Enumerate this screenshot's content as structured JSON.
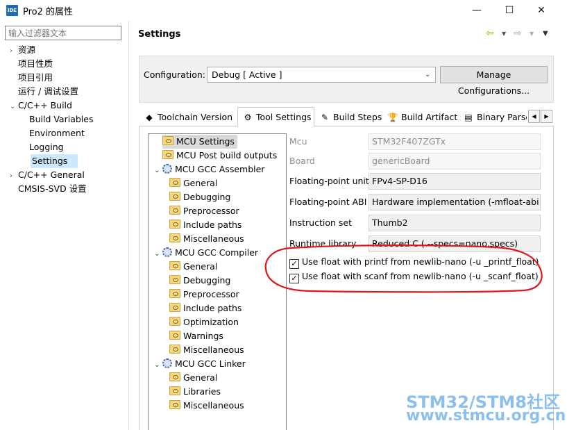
{
  "window": {
    "title": "Pro2 的属性",
    "icon_label": "IDE",
    "minimize": "—",
    "maximize": "☐",
    "close": "✕"
  },
  "filter": {
    "placeholder": "输入过滤器文本"
  },
  "nav": [
    {
      "label": "资源",
      "arrow": "›"
    },
    {
      "label": "项目性质",
      "arrow": ""
    },
    {
      "label": "项目引用",
      "arrow": ""
    },
    {
      "label": "运行 / 调试设置",
      "arrow": ""
    },
    {
      "label": "C/C++ Build",
      "arrow": "⌄"
    },
    {
      "label": "Build Variables",
      "arrow": ""
    },
    {
      "label": "Environment",
      "arrow": ""
    },
    {
      "label": "Logging",
      "arrow": ""
    },
    {
      "label": "Settings",
      "arrow": ""
    },
    {
      "label": "C/C++ General",
      "arrow": "›"
    },
    {
      "label": "CMSIS-SVD 设置",
      "arrow": ""
    }
  ],
  "header": {
    "title": "Settings",
    "back_icon": "⇦",
    "fwd_icon": "⇨",
    "menu_icon": "▼"
  },
  "config": {
    "label": "Configuration:",
    "value": "Debug  [ Active ]",
    "manage": "Manage Configurations..."
  },
  "tabs": [
    {
      "label": "Toolchain  Version",
      "icon": "◆"
    },
    {
      "label": "Tool Settings",
      "icon": "⚙"
    },
    {
      "label": "Build Steps",
      "icon": "✎"
    },
    {
      "label": "Build Artifact",
      "icon": "🏆"
    },
    {
      "label": "Binary Parse",
      "icon": "▤"
    }
  ],
  "tree": [
    {
      "label": "MCU Settings",
      "type": "folder",
      "level": 1,
      "arrow": ""
    },
    {
      "label": "MCU Post build outputs",
      "type": "folder",
      "level": 1,
      "arrow": ""
    },
    {
      "label": "MCU GCC Assembler",
      "type": "gear",
      "level": 0,
      "arrow": "⌄"
    },
    {
      "label": "General",
      "type": "folder",
      "level": 2,
      "arrow": ""
    },
    {
      "label": "Debugging",
      "type": "folder",
      "level": 2,
      "arrow": ""
    },
    {
      "label": "Preprocessor",
      "type": "folder",
      "level": 2,
      "arrow": ""
    },
    {
      "label": "Include paths",
      "type": "folder",
      "level": 2,
      "arrow": ""
    },
    {
      "label": "Miscellaneous",
      "type": "folder",
      "level": 2,
      "arrow": ""
    },
    {
      "label": "MCU GCC Compiler",
      "type": "gear",
      "level": 0,
      "arrow": "⌄"
    },
    {
      "label": "General",
      "type": "folder",
      "level": 2,
      "arrow": ""
    },
    {
      "label": "Debugging",
      "type": "folder",
      "level": 2,
      "arrow": ""
    },
    {
      "label": "Preprocessor",
      "type": "folder",
      "level": 2,
      "arrow": ""
    },
    {
      "label": "Include paths",
      "type": "folder",
      "level": 2,
      "arrow": ""
    },
    {
      "label": "Optimization",
      "type": "folder",
      "level": 2,
      "arrow": ""
    },
    {
      "label": "Warnings",
      "type": "folder",
      "level": 2,
      "arrow": ""
    },
    {
      "label": "Miscellaneous",
      "type": "folder",
      "level": 2,
      "arrow": ""
    },
    {
      "label": "MCU GCC Linker",
      "type": "gear",
      "level": 0,
      "arrow": "⌄"
    },
    {
      "label": "General",
      "type": "folder",
      "level": 2,
      "arrow": ""
    },
    {
      "label": "Libraries",
      "type": "folder",
      "level": 2,
      "arrow": ""
    },
    {
      "label": "Miscellaneous",
      "type": "folder",
      "level": 2,
      "arrow": ""
    }
  ],
  "fields": [
    {
      "label": "Mcu",
      "value": "STM32F407ZGTx",
      "disabled": true
    },
    {
      "label": "Board",
      "value": "genericBoard",
      "disabled": true
    },
    {
      "label": "Floating-point unit",
      "value": "FPv4-SP-D16",
      "disabled": false
    },
    {
      "label": "Floating-point ABI",
      "value": "Hardware implementation (-mfloat-abi=ha",
      "disabled": false
    },
    {
      "label": "Instruction set",
      "value": "Thumb2",
      "disabled": false
    },
    {
      "label": "Runtime library",
      "value": "Reduced C ( --specs=nano.specs)",
      "disabled": false
    }
  ],
  "checks": [
    {
      "label": "Use float with printf from newlib-nano (-u _printf_float)",
      "checked": true
    },
    {
      "label": "Use float with scanf from newlib-nano (-u _scanf_float)",
      "checked": true
    }
  ],
  "watermark": {
    "line1": "STM32/STM8社区",
    "line2": "www.stmcu.org.cn"
  },
  "colors": {
    "selection": "#cce8ff",
    "annotation": "#e0151b",
    "watermark": "#8cc0ec"
  }
}
